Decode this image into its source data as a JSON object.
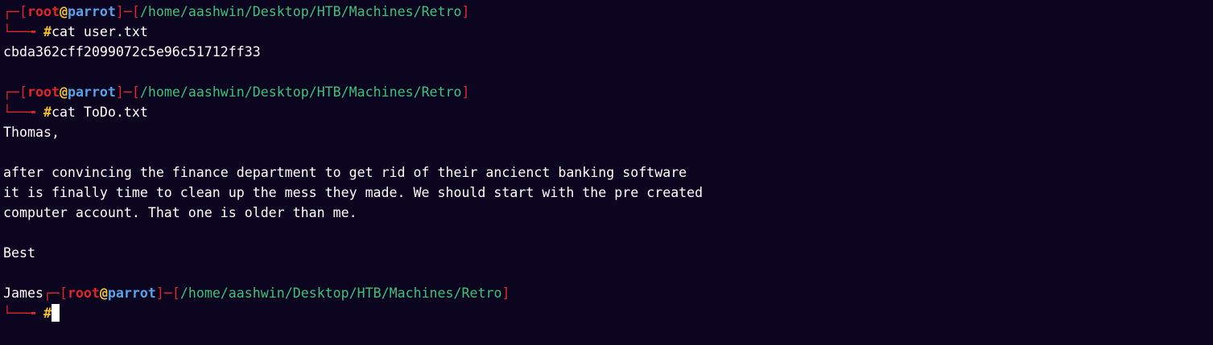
{
  "colors": {
    "background": "#0b0520",
    "bracket": "#e0262b",
    "user": "#e0262b",
    "at": "#f3c22c",
    "host": "#5aa2e6",
    "path": "#3ec27a",
    "hash": "#f3c22c",
    "text": "#ffffff"
  },
  "prompt": {
    "top_left": "┌─",
    "bottom_left": "└──╼ ",
    "open_bracket": "[",
    "close_bracket": "]",
    "dash": "─",
    "user": "root",
    "at": "@",
    "host": "parrot",
    "path": "/home/aashwin/Desktop/HTB/Machines/Retro",
    "symbol": "#"
  },
  "commands": [
    "cat user.txt",
    "cat ToDo.txt"
  ],
  "outputs": {
    "user_txt": "cbda362cff2099072c5e96c51712ff33",
    "todo_lines": [
      "Thomas,",
      "",
      "after convincing the finance department to get rid of their ancienct banking software",
      "it is finally time to clean up the mess they made. We should start with the pre created",
      "computer account. That one is older than me.",
      "",
      "Best",
      ""
    ],
    "todo_last": "James"
  }
}
